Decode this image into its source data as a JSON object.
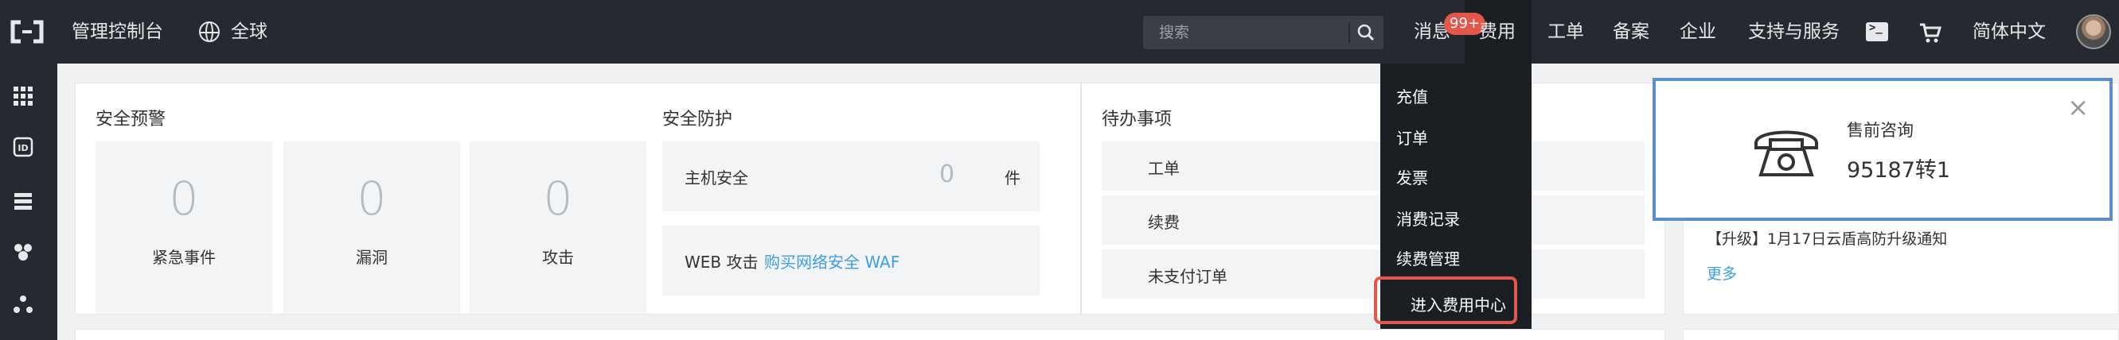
{
  "topbar": {
    "logo_icon": "aliyun-logo-icon",
    "console_title": "管理控制台",
    "region_icon": "globe-icon",
    "region_label": "全球",
    "search_placeholder": "搜索",
    "messages_label": "消息",
    "messages_badge": "99+",
    "fee_label": "费用",
    "ticket_label": "工单",
    "icp_label": "备案",
    "enterprise_label": "企业",
    "support_label": "支持与服务",
    "terminal_icon": "terminal-icon",
    "cart_icon": "cart-icon",
    "language_label": "简体中文",
    "avatar_icon": "user-avatar"
  },
  "sidebar": {
    "icons": [
      "grid-icon",
      "ide-icon",
      "server-icon",
      "cluster-icon",
      "nodes-icon"
    ]
  },
  "security_alert": {
    "title": "安全预警",
    "stats": [
      {
        "value": "0",
        "label": "紧急事件"
      },
      {
        "value": "0",
        "label": "漏洞"
      },
      {
        "value": "0",
        "label": "攻击"
      }
    ]
  },
  "security_protect": {
    "title": "安全防护",
    "host_label": "主机安全",
    "host_value": "0",
    "host_unit": "件",
    "web_label": "WEB 攻击",
    "web_link": "购买网络安全 WAF"
  },
  "todo": {
    "title": "待办事项",
    "items": [
      "工单",
      "续费",
      "未支付订单"
    ]
  },
  "notice": {
    "text": "【升级】1月17日云盾高防升级通知",
    "more": "更多"
  },
  "fee_dropdown": {
    "items": [
      "充值",
      "订单",
      "发票",
      "消费记录",
      "续费管理"
    ],
    "highlight_item": "进入费用中心",
    "highlight_color": "#e2574c"
  },
  "presales_popup": {
    "title": "售前咨询",
    "phone": "95187转1",
    "close_label": "×",
    "border_color": "#5b8fc7"
  },
  "colors": {
    "topbar_bg": "#262a30",
    "accent_link": "#3c9ee0",
    "badge": "#e2574c"
  }
}
